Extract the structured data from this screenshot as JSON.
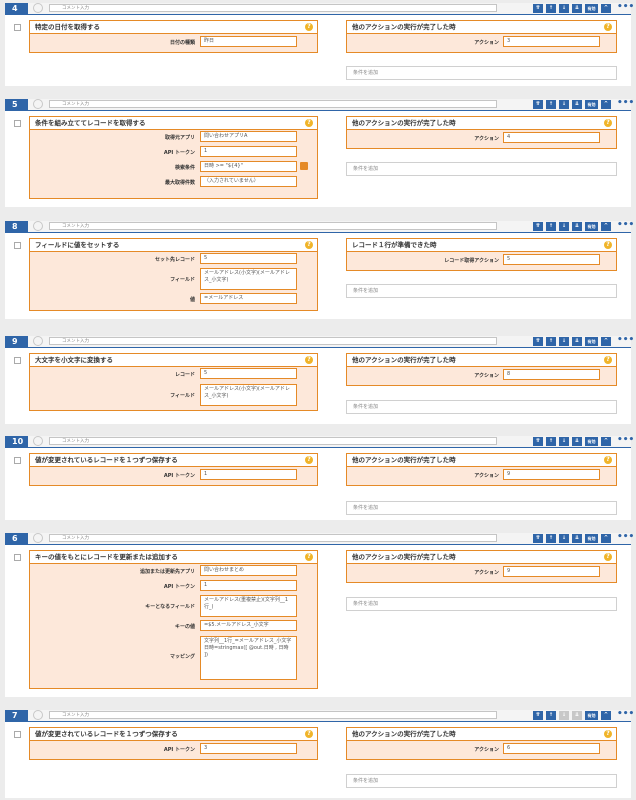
{
  "common": {
    "comment_placeholder": "コメント入力",
    "add_condition": "条件を追加",
    "btn_top": "⇈",
    "btn_up": "↑",
    "btn_down": "↓",
    "btn_bottom": "⇊",
    "btn_enabled": "有効",
    "btn_collapse": "^",
    "btn_more": "•••",
    "help": "?"
  },
  "blocks": [
    {
      "num": "4",
      "action": {
        "title": "特定の日付を取得する",
        "fields": [
          {
            "label": "日付の種類",
            "value": "昨日"
          }
        ]
      },
      "trigger": {
        "title": "他のアクションの実行が完了した時",
        "field": {
          "label": "アクション",
          "value": "3"
        }
      }
    },
    {
      "num": "5",
      "action": {
        "title": "条件を組み立ててレコードを取得する",
        "fields": [
          {
            "label": "取得元アプリ",
            "value": "問い合わせアプリA"
          },
          {
            "label": "API トークン",
            "value": "1"
          },
          {
            "label": "検索条件",
            "value": "日時 >= \"${4}\""
          },
          {
            "label": "最大取得件数",
            "value": "（入力されていません）"
          }
        ]
      },
      "trigger": {
        "title": "他のアクションの実行が完了した時",
        "field": {
          "label": "アクション",
          "value": "4"
        }
      }
    },
    {
      "num": "8",
      "action": {
        "title": "フィールドに値をセットする",
        "fields": [
          {
            "label": "セット先レコード",
            "value": "5"
          },
          {
            "label": "フィールド",
            "value": "メールアドレス(小文字)(メールアドレス_小文字)"
          },
          {
            "label": "値",
            "value": "=メールアドレス"
          }
        ]
      },
      "trigger": {
        "title": "レコード１行が準備できた時",
        "field": {
          "label": "レコード取得アクション",
          "value": "5"
        }
      }
    },
    {
      "num": "9",
      "action": {
        "title": "大文字を小文字に変換する",
        "fields": [
          {
            "label": "レコード",
            "value": "5"
          },
          {
            "label": "フィールド",
            "value": "メールアドレス(小文字)(メールアドレス_小文字)"
          }
        ]
      },
      "trigger": {
        "title": "他のアクションの実行が完了した時",
        "field": {
          "label": "アクション",
          "value": "8"
        }
      }
    },
    {
      "num": "10",
      "action": {
        "title": "値が変更されているレコードを１つずつ保存する",
        "fields": [
          {
            "label": "API トークン",
            "value": "1"
          }
        ]
      },
      "trigger": {
        "title": "他のアクションの実行が完了した時",
        "field": {
          "label": "アクション",
          "value": "9"
        }
      }
    },
    {
      "num": "6",
      "action": {
        "title": "キーの値をもとにレコードを更新または追加する",
        "fields": [
          {
            "label": "追加または更新先アプリ",
            "value": "問い合わせまとめ"
          },
          {
            "label": "API トークン",
            "value": "1"
          },
          {
            "label": "キーとなるフィールド",
            "value": "メールアドレス(重複禁止)(文字列__1行_)"
          },
          {
            "label": "キーの値",
            "value": "=$5.メールアドレス_小文字"
          },
          {
            "label": "マッピング",
            "value": "文字列__1行_=メールアドレス_小文字\n日時=stringmax([ @out.日時 , 日時 ])"
          }
        ]
      },
      "trigger": {
        "title": "他のアクションの実行が完了した時",
        "field": {
          "label": "アクション",
          "value": "9"
        }
      }
    },
    {
      "num": "7",
      "action": {
        "title": "値が変更されているレコードを１つずつ保存する",
        "fields": [
          {
            "label": "API トークン",
            "value": "3"
          }
        ]
      },
      "trigger": {
        "title": "他のアクションの実行が完了した時",
        "field": {
          "label": "アクション",
          "value": "6"
        }
      }
    }
  ]
}
